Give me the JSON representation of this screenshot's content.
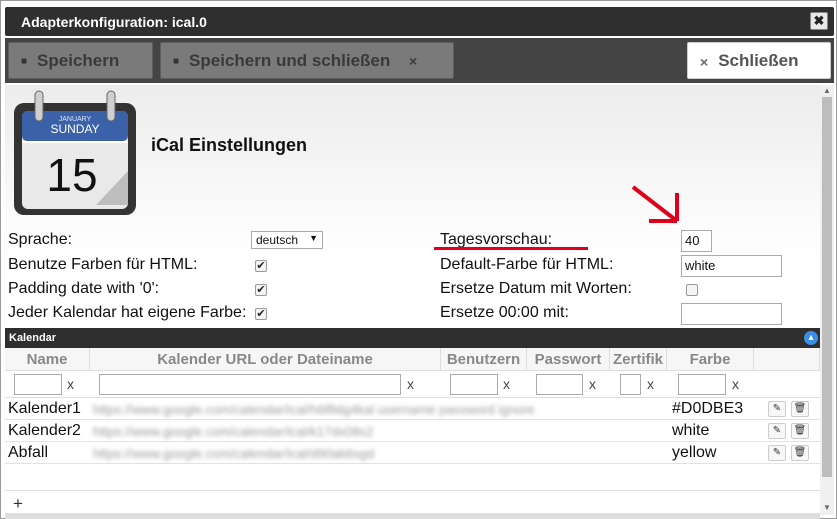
{
  "window": {
    "title": "Adapterkonfiguration: ical.0",
    "close_label": "✖"
  },
  "toolbar": {
    "save_label": "Speichern",
    "save_close_label": "Speichern und schließen",
    "save_close_x": "×",
    "close_label": "Schließen",
    "close_x": "×"
  },
  "logo": {
    "month": "JANUARY",
    "day": "SUNDAY",
    "date": "15"
  },
  "heading": "iCal Einstellungen",
  "settings": {
    "language_label": "Sprache:",
    "language_value": "deutsch",
    "use_colors_label": "Benutze Farben für HTML:",
    "padding_label": "Padding date with '0':",
    "own_color_label": "Jeder Kalendar hat eigene Farbe:",
    "days_preview_label": "Tagesvorschau:",
    "days_preview_value": "40",
    "default_color_label": "Default-Farbe für HTML:",
    "default_color_value": "white",
    "replace_date_label": "Ersetze Datum mit Worten:",
    "replace_midnight_label": "Ersetze 00:00 mit:",
    "replace_midnight_value": ""
  },
  "grid": {
    "title": "Kalendar",
    "columns": [
      "Name",
      "Kalender URL oder Dateiname",
      "Benutzern",
      "Passwort",
      "Zertifik",
      "Farbe"
    ],
    "filter_clear": "x",
    "rows": [
      {
        "name": "Kalender1",
        "url": "https://www.google.com/calendar/ical/h6f8dg4kal username  password  ignore",
        "color": "#D0DBE3"
      },
      {
        "name": "Kalender2",
        "url": "https://www.google.com/calendar/ical/k17dx08s2",
        "color": "white"
      },
      {
        "name": "Abfall",
        "url": "https://www.google.com/calendar/ical/d90ak6sgd",
        "color": "yellow"
      }
    ],
    "add_label": "+"
  },
  "colors": {
    "titlebar": "#2f2f2f",
    "accent_red": "#e0001b",
    "collapse_icon": "#3a8ee6"
  }
}
